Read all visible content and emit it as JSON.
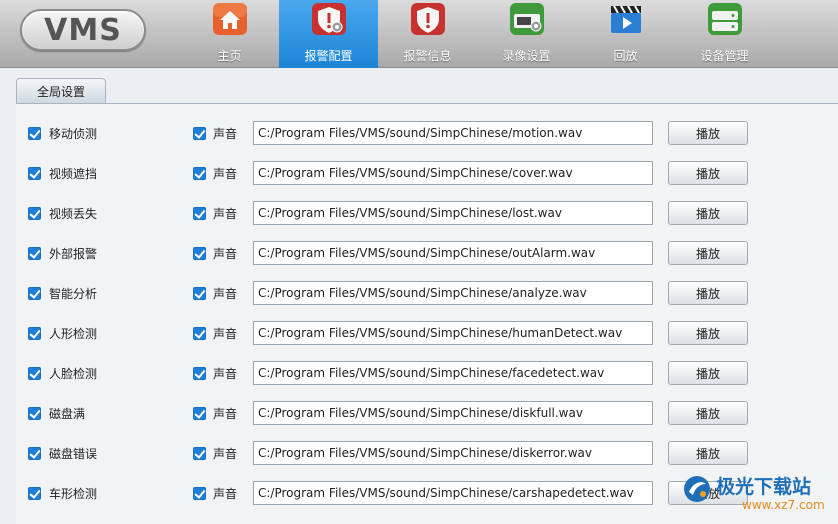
{
  "logo": {
    "text": "VMS"
  },
  "nav": [
    {
      "label": "主页",
      "icon": "home-icon",
      "active": false
    },
    {
      "label": "报警配置",
      "icon": "alarm-config-icon",
      "active": true
    },
    {
      "label": "报警信息",
      "icon": "alarm-info-icon",
      "active": false
    },
    {
      "label": "录像设置",
      "icon": "record-settings-icon",
      "active": false
    },
    {
      "label": "回放",
      "icon": "playback-icon",
      "active": false
    },
    {
      "label": "设备管理",
      "icon": "device-management-icon",
      "active": false
    }
  ],
  "tab": {
    "label": "全局设置"
  },
  "rows": [
    {
      "name": "移动侦测",
      "sound_label": "声音",
      "path": "C:/Program Files/VMS/sound/SimpChinese/motion.wav",
      "play_label": "播放",
      "enabled": true,
      "sound_on": true
    },
    {
      "name": "视频遮挡",
      "sound_label": "声音",
      "path": "C:/Program Files/VMS/sound/SimpChinese/cover.wav",
      "play_label": "播放",
      "enabled": true,
      "sound_on": true
    },
    {
      "name": "视频丢失",
      "sound_label": "声音",
      "path": "C:/Program Files/VMS/sound/SimpChinese/lost.wav",
      "play_label": "播放",
      "enabled": true,
      "sound_on": true
    },
    {
      "name": "外部报警",
      "sound_label": "声音",
      "path": "C:/Program Files/VMS/sound/SimpChinese/outAlarm.wav",
      "play_label": "播放",
      "enabled": true,
      "sound_on": true
    },
    {
      "name": "智能分析",
      "sound_label": "声音",
      "path": "C:/Program Files/VMS/sound/SimpChinese/analyze.wav",
      "play_label": "播放",
      "enabled": true,
      "sound_on": true
    },
    {
      "name": "人形检测",
      "sound_label": "声音",
      "path": "C:/Program Files/VMS/sound/SimpChinese/humanDetect.wav",
      "play_label": "播放",
      "enabled": true,
      "sound_on": true
    },
    {
      "name": "人脸检测",
      "sound_label": "声音",
      "path": "C:/Program Files/VMS/sound/SimpChinese/facedetect.wav",
      "play_label": "播放",
      "enabled": true,
      "sound_on": true
    },
    {
      "name": "磁盘满",
      "sound_label": "声音",
      "path": "C:/Program Files/VMS/sound/SimpChinese/diskfull.wav",
      "play_label": "播放",
      "enabled": true,
      "sound_on": true
    },
    {
      "name": "磁盘错误",
      "sound_label": "声音",
      "path": "C:/Program Files/VMS/sound/SimpChinese/diskerror.wav",
      "play_label": "播放",
      "enabled": true,
      "sound_on": true
    },
    {
      "name": "车形检测",
      "sound_label": "声音",
      "path": "C:/Program Files/VMS/sound/SimpChinese/carshapedetect.wav",
      "play_label": "播放",
      "enabled": true,
      "sound_on": true
    }
  ],
  "watermark": {
    "name": "极光下载站",
    "url": "www.xz7.com"
  },
  "colors": {
    "accent": "#1e84d8",
    "checkbox": "#1e7fd8",
    "panel": "#f1f3f5"
  }
}
